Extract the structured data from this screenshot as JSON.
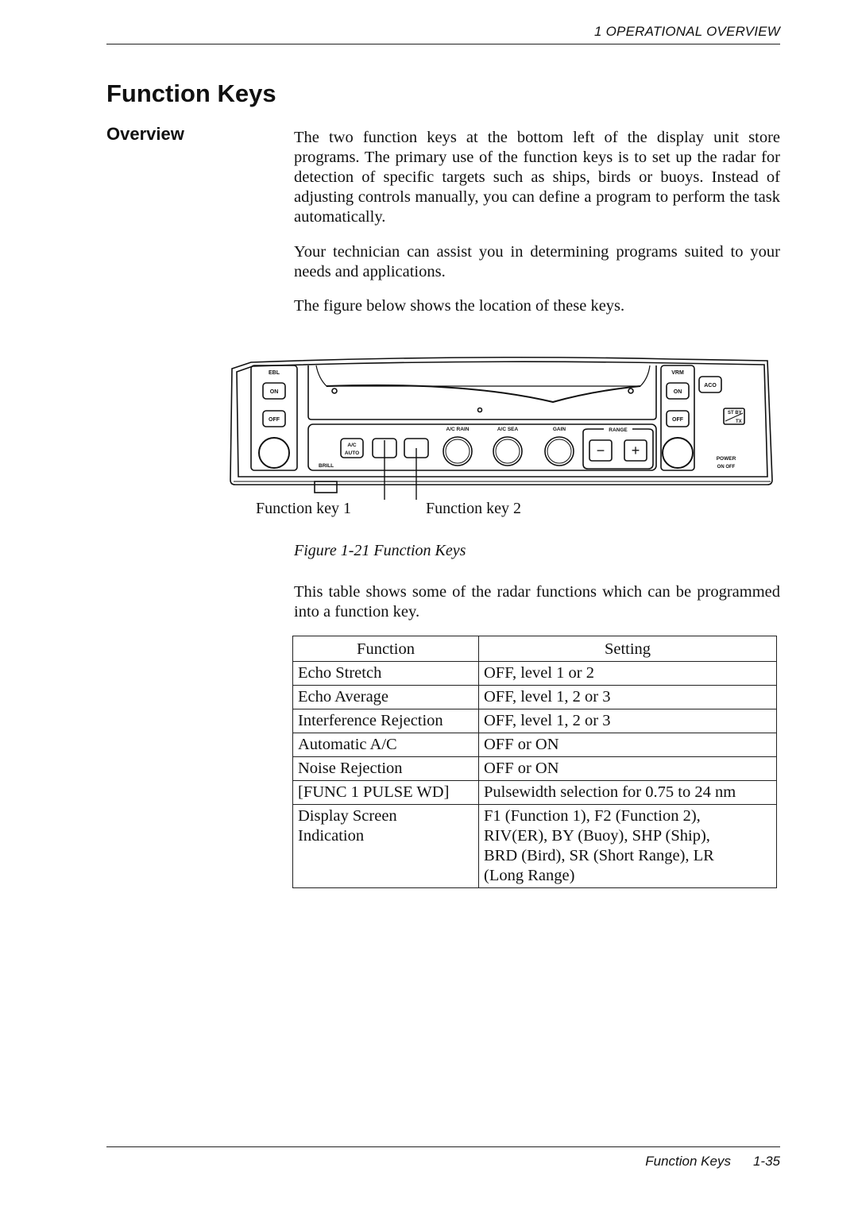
{
  "header": {
    "running_title": "1 OPERATIONAL OVERVIEW"
  },
  "page": {
    "title": "Function Keys",
    "section": "Overview"
  },
  "body": {
    "para1": "The two function keys at the bottom left of the display unit store programs. The primary use of the function keys is to set up the radar for detection of specific targets such as ships, birds or buoys. Instead of adjusting controls manually, you can define a program to perform the task automatically.",
    "para2": "Your technician can assist you in determining programs suited to your needs and applications.",
    "para3": "The figure below shows the location of these keys.",
    "para4": "This table shows some of the radar functions which can be programmed into a function key."
  },
  "figure": {
    "caption": "Figure 1-21 Function Keys",
    "callouts": {
      "key1": "Function key 1",
      "key2": "Function key 2"
    },
    "panel_labels": {
      "ebl": "EBL",
      "ebl_on": "ON",
      "ebl_off": "OFF",
      "ac_auto_1": "A/C",
      "ac_auto_2": "AUTO",
      "drill": "BRILL",
      "ac_rain": "A/C RAIN",
      "ac_sea": "A/C SEA",
      "gain": "GAIN",
      "range": "RANGE",
      "range_minus": "−",
      "range_plus": "+",
      "vrm": "VRM",
      "vrm_on": "ON",
      "vrm_off": "OFF",
      "aco": "ACO",
      "stby": "ST BY",
      "tx": "TX",
      "power": "POWER",
      "power_states": "ON  OFF"
    }
  },
  "table": {
    "headers": [
      "Function",
      "Setting"
    ],
    "rows": [
      {
        "function": "Echo Stretch",
        "setting": "OFF, level 1 or 2"
      },
      {
        "function": "Echo Average",
        "setting": "OFF, level 1, 2 or 3"
      },
      {
        "function": "Interference Rejection",
        "setting": "OFF, level 1, 2 or 3"
      },
      {
        "function": "Automatic A/C",
        "setting": "OFF or ON"
      },
      {
        "function": "Noise Rejection",
        "setting": "OFF or ON"
      },
      {
        "function": "[FUNC 1 PULSE WD]",
        "setting": "Pulsewidth selection for 0.75 to 24 nm"
      },
      {
        "function_lines": [
          "Display Screen",
          "Indication"
        ],
        "setting_lines": [
          "F1 (Function 1), F2 (Function 2),",
          "RIV(ER), BY (Buoy), SHP (Ship),",
          "BRD (Bird), SR (Short Range), LR",
          "(Long Range)"
        ]
      }
    ]
  },
  "footer": {
    "section": "Function Keys",
    "page_number": "1-35"
  }
}
